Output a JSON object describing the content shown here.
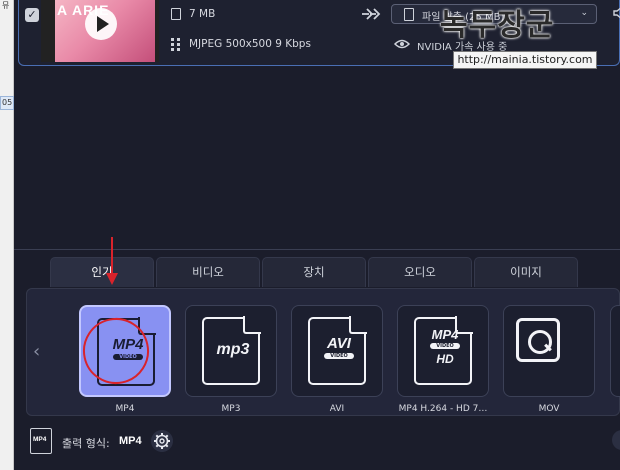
{
  "file": {
    "thumbnail_text": "A  ARIE",
    "size": "7 MB",
    "codec": "MJPEG 500x500 9 Kbps",
    "target_label": "파일 압축 (25 MB)",
    "gpu_label": "NVIDIA 가속 사용 중"
  },
  "watermark": {
    "title": "녹두장군",
    "url": "http://mainia.tistory.com"
  },
  "left_strip": {
    "tick1": "뮤",
    "tick2": "05"
  },
  "tabs": [
    {
      "label": "인기"
    },
    {
      "label": "비디오"
    },
    {
      "label": "장치"
    },
    {
      "label": "오디오"
    },
    {
      "label": "이미지"
    }
  ],
  "formats": [
    {
      "label": "MP4",
      "icon": "MP4",
      "badge": "VIDEO",
      "selected": true
    },
    {
      "label": "MP3",
      "icon": "mp3"
    },
    {
      "label": "AVI",
      "icon": "AVI",
      "badge": "VIDEO"
    },
    {
      "label": "MP4 H.264 - HD 7…",
      "icon": "MP4",
      "badge": "VIDEO",
      "sub": "HD"
    },
    {
      "label": "MOV",
      "icon": "quicktime-icon"
    }
  ],
  "footer": {
    "icon_text": "MP4",
    "output_label": "출력 형식:",
    "output_value": "MP4"
  },
  "colors": {
    "background": "#1b1d2b",
    "selected_tile": "#8891f2",
    "annotation": "#d9232b"
  }
}
